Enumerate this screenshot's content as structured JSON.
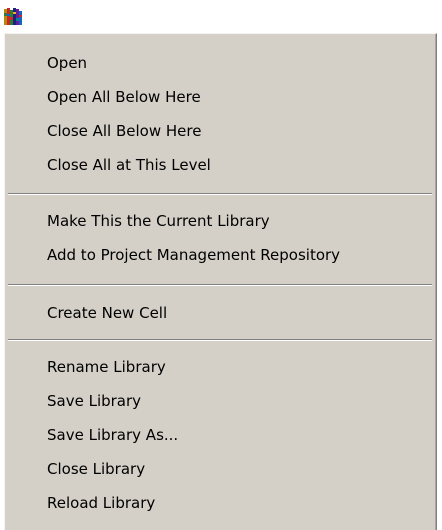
{
  "app_icon": "library-books-icon",
  "colors": {
    "menu_background": "#d4d0c8",
    "separator_dark": "#808080",
    "separator_light": "#ffffff",
    "text": "#000000"
  },
  "menu": {
    "groups": [
      [
        "Open",
        "Open All Below Here",
        "Close All Below Here",
        "Close All at This Level"
      ],
      [
        "Make This the Current Library",
        "Add to Project Management Repository"
      ],
      [
        "Create New Cell"
      ],
      [
        "Rename Library",
        "Save Library",
        "Save Library As...",
        "Close Library",
        "Reload Library"
      ]
    ]
  }
}
